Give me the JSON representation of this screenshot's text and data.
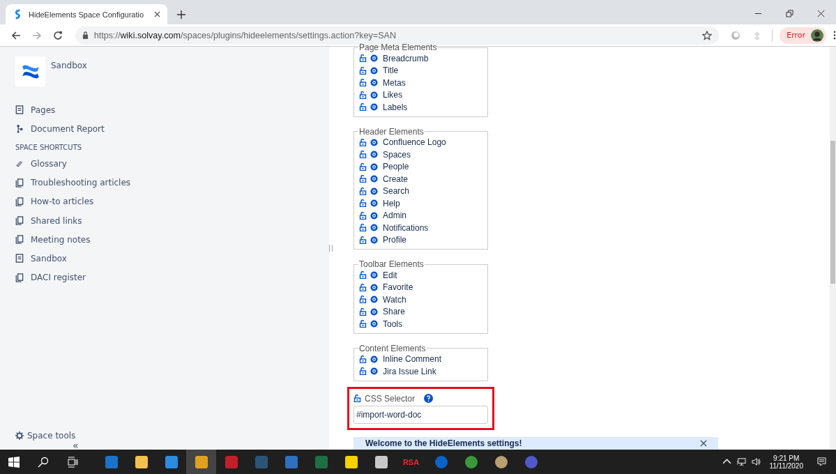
{
  "browser": {
    "tab_title": "HideElements Space Configuratio",
    "url": "https://**wiki.solvay.com**/spaces/plugins/hideelements/settings.action?key=SAN",
    "profile_status": "Error"
  },
  "sidebar": {
    "space_name": "Sandbox",
    "nav": [
      {
        "label": "Pages",
        "kind": "page"
      },
      {
        "label": "Document Report",
        "kind": "tree"
      }
    ],
    "shortcuts_heading": "SPACE SHORTCUTS",
    "shortcuts": [
      {
        "label": "Glossary",
        "kind": "glossary"
      },
      {
        "label": "Troubleshooting articles",
        "kind": "copy"
      },
      {
        "label": "How-to articles",
        "kind": "copy"
      },
      {
        "label": "Shared links",
        "kind": "copy"
      },
      {
        "label": "Meeting notes",
        "kind": "copy"
      },
      {
        "label": "Sandbox",
        "kind": "page"
      },
      {
        "label": "DACI register",
        "kind": "copy"
      }
    ],
    "footer": "Space tools",
    "collapse": "«"
  },
  "groups": [
    {
      "legend": "Page Meta Elements",
      "items": [
        "Breadcrumb",
        "Title",
        "Metas",
        "Likes",
        "Labels"
      ]
    },
    {
      "legend": "Header Elements",
      "items": [
        "Confluence Logo",
        "Spaces",
        "People",
        "Create",
        "Search",
        "Help",
        "Admin",
        "Notifications",
        "Profile"
      ]
    },
    {
      "legend": "Toolbar Elements",
      "items": [
        "Edit",
        "Favorite",
        "Watch",
        "Share",
        "Tools"
      ]
    },
    {
      "legend": "Content Elements",
      "items": [
        "Inline Comment",
        "Jira Issue Link"
      ]
    }
  ],
  "css_selector": {
    "label": "CSS Selector",
    "value": "#import-word-doc"
  },
  "banner": {
    "text": "Welcome to the HideElements settings!"
  },
  "taskbar": {
    "rsa_label": "RSA",
    "time": "9:21 PM",
    "date": "11/11/2020"
  }
}
